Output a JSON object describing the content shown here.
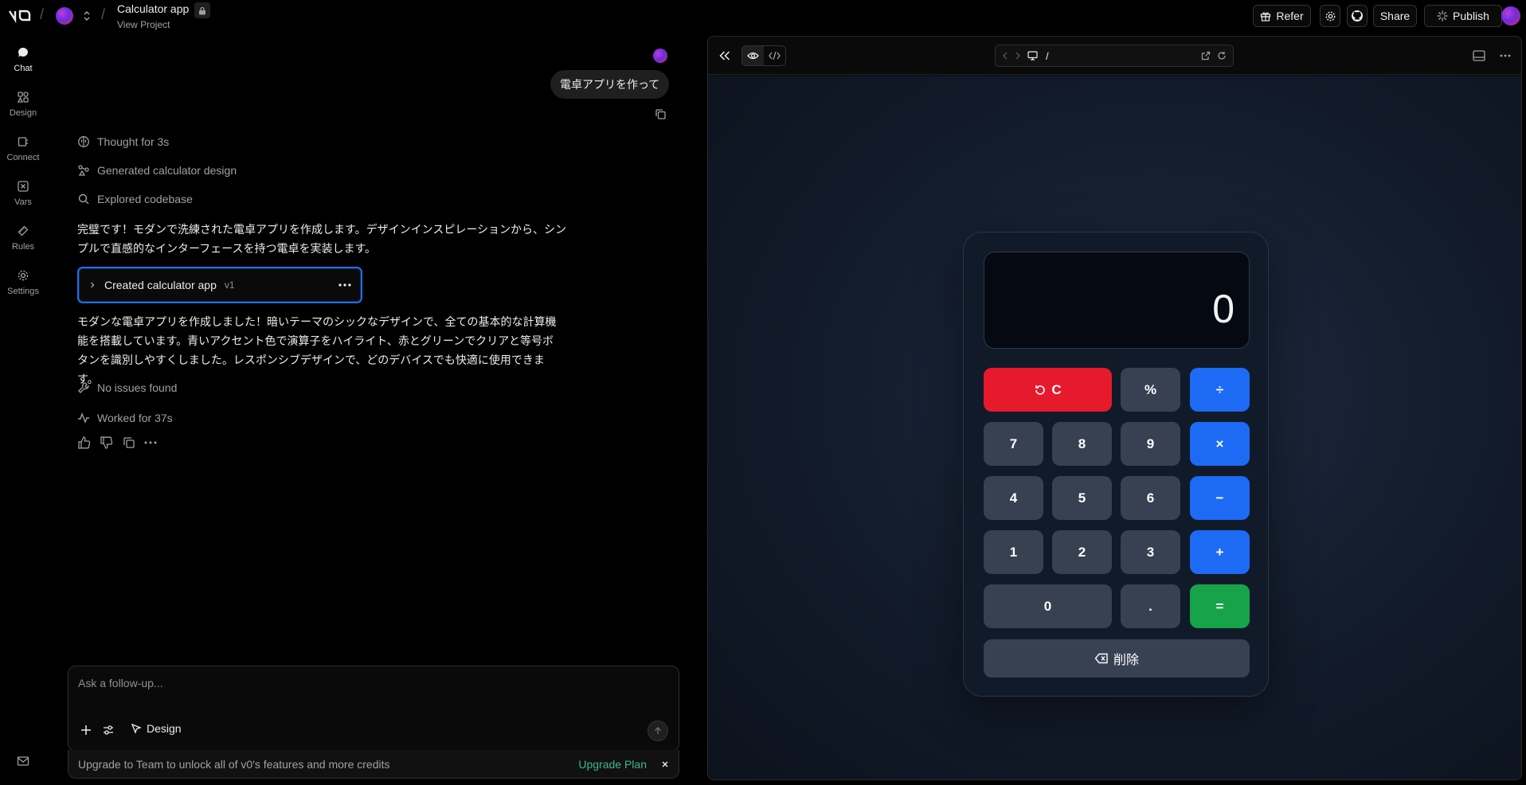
{
  "project": {
    "title": "Calculator app",
    "subtitle": "View Project"
  },
  "header": {
    "refer": "Refer",
    "share": "Share",
    "publish": "Publish"
  },
  "rail": [
    {
      "label": "Chat",
      "icon": "chat-icon"
    },
    {
      "label": "Design",
      "icon": "design-icon"
    },
    {
      "label": "Connect",
      "icon": "connect-icon"
    },
    {
      "label": "Vars",
      "icon": "vars-icon"
    },
    {
      "label": "Rules",
      "icon": "rules-icon"
    },
    {
      "label": "Settings",
      "icon": "settings-icon"
    }
  ],
  "chat": {
    "user_message": "電卓アプリを作って",
    "steps": {
      "thought": "Thought for 3s",
      "generated": "Generated calculator design",
      "explored": "Explored codebase"
    },
    "intro": "完璧です！モダンで洗練された電卓アプリを作成します。デザインインスピレーションから、シンプルで直感的なインターフェースを持つ電卓を実装します。",
    "version_card": {
      "name": "Created calculator app",
      "version": "v1"
    },
    "summary": "モダンな電卓アプリを作成しました！暗いテーマのシックなデザインで、全ての基本的な計算機能を搭載しています。青いアクセント色で演算子をハイライト、赤とグリーンでクリアと等号ボタンを識別しやすくしました。レスポンシブデザインで、どのデバイスでも快適に使用できます。",
    "no_issues": "No issues found",
    "worked": "Worked for 37s"
  },
  "composer": {
    "placeholder": "Ask a follow-up...",
    "design_label": "Design",
    "upgrade_text": "Upgrade to Team to unlock all of v0's features and more credits",
    "upgrade_link": "Upgrade Plan"
  },
  "preview": {
    "url": "/",
    "calculator": {
      "display": "0",
      "clear": "C",
      "percent": "%",
      "divide": "÷",
      "seven": "7",
      "eight": "8",
      "nine": "9",
      "multiply": "×",
      "four": "4",
      "five": "5",
      "six": "6",
      "minus": "−",
      "one": "1",
      "two": "2",
      "three": "3",
      "plus": "+",
      "zero": "0",
      "dot": ".",
      "equals": "=",
      "delete": "削除"
    }
  },
  "colors": {
    "operator": "#1d6bf5",
    "clear": "#e7192d",
    "equals": "#16a34a",
    "digit": "#374151",
    "focus_ring": "#1f6feb",
    "upgrade_link": "#3fb68b"
  }
}
